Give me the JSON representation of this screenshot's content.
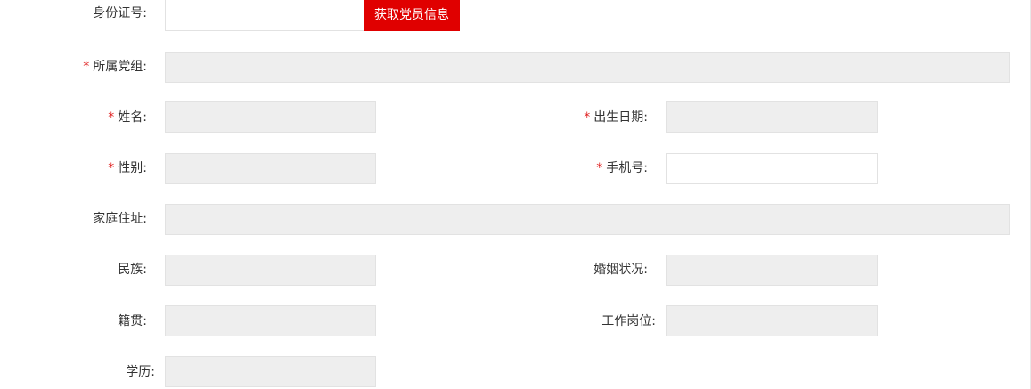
{
  "form": {
    "id_card": {
      "label": "身份证号:",
      "value": "",
      "fetch_button": "获取党员信息"
    },
    "party_group": {
      "required": "*",
      "label": "所属党组:",
      "value": ""
    },
    "name": {
      "required": "*",
      "label": "姓名:",
      "value": ""
    },
    "birth_date": {
      "required": "*",
      "label": "出生日期:",
      "value": ""
    },
    "gender": {
      "required": "*",
      "label": "性别:",
      "value": ""
    },
    "phone": {
      "required": "*",
      "label": "手机号:",
      "value": ""
    },
    "home_address": {
      "label": "家庭住址:",
      "value": ""
    },
    "ethnicity": {
      "label": "民族:",
      "value": ""
    },
    "marital_status": {
      "label": "婚姻状况:",
      "value": ""
    },
    "native_place": {
      "label": "籍贯:",
      "value": ""
    },
    "job_position": {
      "label": "工作岗位:",
      "value": ""
    },
    "education": {
      "label": "学历:",
      "value": ""
    }
  },
  "colors": {
    "required_marker": "#e02020",
    "button_bg": "#e00000",
    "readonly_field_bg": "#eeeeee"
  }
}
